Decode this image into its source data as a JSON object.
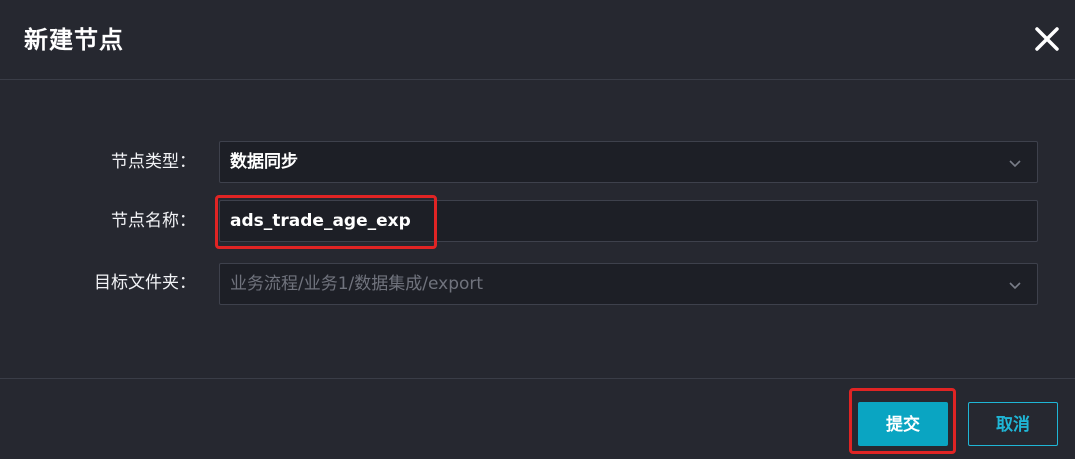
{
  "dialog": {
    "title": "新建节点",
    "close_icon": "close-icon"
  },
  "form": {
    "node_type": {
      "label": "节点类型：",
      "value": "数据同步",
      "icon": "chevron-down-icon"
    },
    "node_name": {
      "label": "节点名称：",
      "value": "ads_trade_age_exp"
    },
    "target_folder": {
      "label": "目标文件夹：",
      "value": "业务流程/业务1/数据集成/export",
      "icon": "chevron-down-icon",
      "disabled": true
    }
  },
  "footer": {
    "submit_label": "提交",
    "cancel_label": "取消"
  },
  "colors": {
    "background": "#262830",
    "accent": "#0aa5c2",
    "highlight": "#e02424"
  }
}
